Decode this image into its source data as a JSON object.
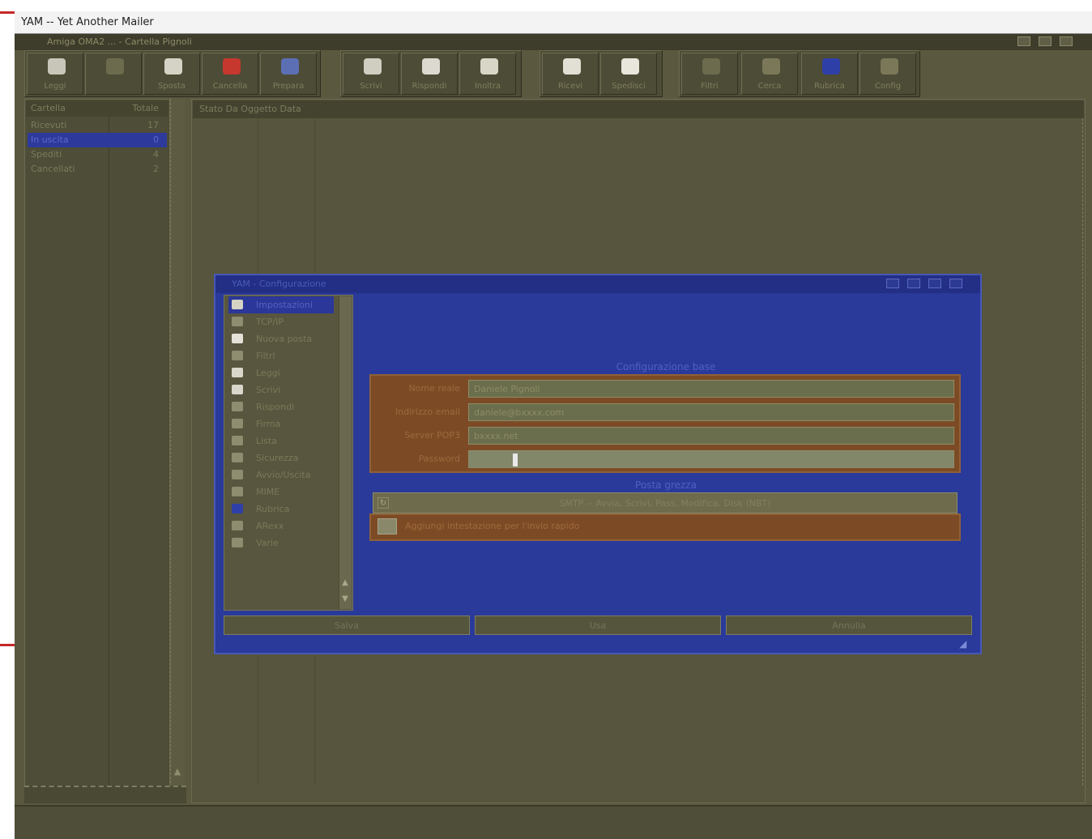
{
  "outer_window": {
    "title": "YAM -- Yet Another Mailer"
  },
  "screen": {
    "title": "Amiga OMA2 ... - Cartella Pignoli"
  },
  "toolbar": {
    "buttons": [
      {
        "label": "Leggi",
        "icon": "read-mail-icon",
        "color": "#c8c6b8"
      },
      {
        "label": "",
        "icon": "edit-icon",
        "color": "#6d6b4e"
      },
      {
        "label": "Sposta",
        "icon": "move-icon",
        "color": "#d5d3c5"
      },
      {
        "label": "Cancella",
        "icon": "delete-icon",
        "color": "#c6372e"
      },
      {
        "label": "Prepara",
        "icon": "compose-icon",
        "color": "#5d6fb4"
      },
      {
        "label": "Scrivi",
        "icon": "write-icon",
        "color": "#d0cec0"
      },
      {
        "label": "Rispondi",
        "icon": "reply-icon",
        "color": "#dcdad0"
      },
      {
        "label": "Inoltra",
        "icon": "forward-icon",
        "color": "#d8d6c6"
      },
      {
        "label": "Ricevi",
        "icon": "receive-icon",
        "color": "#e2e0d4"
      },
      {
        "label": "Spedisci",
        "icon": "send-icon",
        "color": "#e9e7dc"
      },
      {
        "label": "Filtri",
        "icon": "filter-icon",
        "color": "#6d6b4e"
      },
      {
        "label": "Cerca",
        "icon": "search-icon",
        "color": "#7a7859"
      },
      {
        "label": "Rubrica",
        "icon": "addressbook-icon",
        "color": "#2f3fa8"
      },
      {
        "label": "Config",
        "icon": "config-icon",
        "color": "#7a7859"
      }
    ]
  },
  "folders": {
    "header_name": "Cartella",
    "header_count": "Totale",
    "items": [
      {
        "name": "Ricevuti",
        "count": "17"
      },
      {
        "name": "In uscita",
        "count": "0"
      },
      {
        "name": "Spediti",
        "count": "4"
      },
      {
        "name": "Cancellati",
        "count": "2"
      }
    ],
    "selected_index": 1
  },
  "message_list": {
    "header": "Stato  Da  Oggetto  Data"
  },
  "dialog": {
    "title": "YAM - Configurazione",
    "nav_items": [
      {
        "label": "Impostazioni",
        "icon": "settings-icon",
        "color": "#d5d3c4"
      },
      {
        "label": "TCP/IP",
        "icon": "network-icon",
        "color": "#8f8d70"
      },
      {
        "label": "Nuova posta",
        "icon": "newmail-icon",
        "color": "#e4e2d8"
      },
      {
        "label": "Filtri",
        "icon": "filter-icon",
        "color": "#8f8d70"
      },
      {
        "label": "Leggi",
        "icon": "read-icon",
        "color": "#d9d7cb"
      },
      {
        "label": "Scrivi",
        "icon": "write-icon",
        "color": "#d9d7cb"
      },
      {
        "label": "Rispondi",
        "icon": "reply-icon",
        "color": "#8f8d70"
      },
      {
        "label": "Firma",
        "icon": "signature-icon",
        "color": "#8f8d70"
      },
      {
        "label": "Lista",
        "icon": "list-icon",
        "color": "#8f8d70"
      },
      {
        "label": "Sicurezza",
        "icon": "security-icon",
        "color": "#8f8d70"
      },
      {
        "label": "Avvio/Uscita",
        "icon": "startup-icon",
        "color": "#8f8d70"
      },
      {
        "label": "MIME",
        "icon": "mime-icon",
        "color": "#8f8d70"
      },
      {
        "label": "Rubrica",
        "icon": "addressbook-icon",
        "color": "#2f3fa8"
      },
      {
        "label": "ARexx",
        "icon": "arexx-icon",
        "color": "#8f8d70"
      },
      {
        "label": "Varie",
        "icon": "misc-icon",
        "color": "#8f8d70"
      }
    ],
    "selected_nav_index": 0,
    "section_basic_title": "Configurazione base",
    "fields": [
      {
        "label": "Nome reale",
        "value": "Daniele Pignoli"
      },
      {
        "label": "Indirizzo email",
        "value": "daniele@bxxxx.com"
      },
      {
        "label": "Server POP3",
        "value": "bxxxx.net"
      },
      {
        "label": "Password",
        "value": ""
      }
    ],
    "section_check_title": "Posta grezza",
    "check_mode": "SMTP -- Avvia, Scrivi, Pass, Modifica, Disk (NBT)",
    "check_box_label": "Aggiungi intestazione per l'invio rapido",
    "buttons": {
      "save": "Salva",
      "use": "Usa",
      "cancel": "Annulla"
    }
  },
  "status_bar": {
    "text": ""
  },
  "colors": {
    "workbench_bg": "#5a583e",
    "dialog_bg": "#2a3a9a",
    "form_bg": "#7c4b26",
    "selection": "#2d3a9c",
    "red_marker": "#c62828"
  }
}
